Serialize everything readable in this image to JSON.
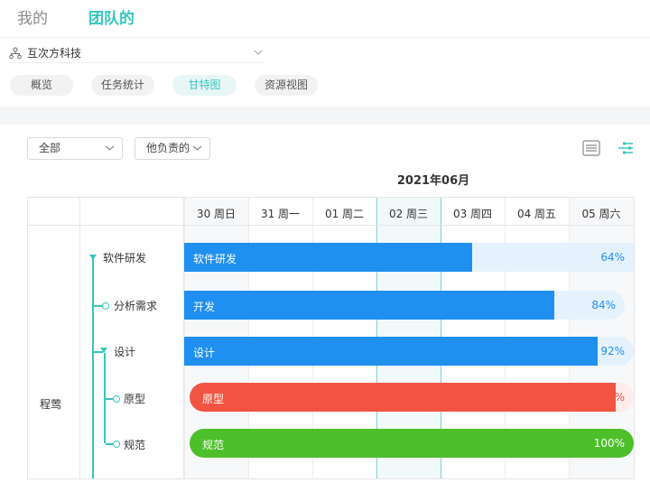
{
  "top_tabs": [
    {
      "label": "我的",
      "active": false
    },
    {
      "label": "团队的",
      "active": true
    }
  ],
  "org": {
    "name": "互次方科技"
  },
  "sub_tabs": [
    {
      "label": "概览"
    },
    {
      "label": "任务统计"
    },
    {
      "label": "甘特图",
      "active": true
    },
    {
      "label": "资源视图"
    }
  ],
  "filters": {
    "scope": "全部",
    "owner": "他负责的"
  },
  "view_icons": [
    "list-view-icon",
    "gantt-view-icon"
  ],
  "gantt": {
    "month": "2021年06月",
    "days": [
      "30 周日",
      "31 周一",
      "01 周二",
      "02 周三",
      "03 周四",
      "04 周五",
      "05 周六"
    ],
    "today_index": 3,
    "assignee": "程莺",
    "tasks": [
      {
        "name": "软件研发",
        "bar_label": "软件研发",
        "percent": "64%",
        "progress": 0.64,
        "color": "#1f8ff0",
        "track": "#e5f2fd",
        "pct_color": "#1f8ff0"
      },
      {
        "name": "分析需求",
        "bar_label": "开发",
        "percent": "84%",
        "progress": 0.84,
        "color": "#1f8ff0",
        "track": "#e5f2fd",
        "pct_color": "#1f8ff0"
      },
      {
        "name": "设计",
        "bar_label": "设计",
        "percent": "92%",
        "progress": 0.92,
        "color": "#1f8ff0",
        "track": "#e5f2fd",
        "pct_color": "#1f8ff0"
      },
      {
        "name": "原型",
        "bar_label": "原型",
        "percent": "96%",
        "progress": 0.96,
        "color": "#f25443",
        "track": "#fdeceb",
        "pct_color": "#f25443"
      },
      {
        "name": "规范",
        "bar_label": "规范",
        "percent": "100%",
        "progress": 1.0,
        "color": "#4cbf2a",
        "track": "#e8f7e3",
        "pct_color": "#ffffff"
      }
    ]
  },
  "colors": {
    "accent": "#36c6bd",
    "blue": "#1f8ff0",
    "red": "#f25443",
    "green": "#4cbf2a"
  }
}
